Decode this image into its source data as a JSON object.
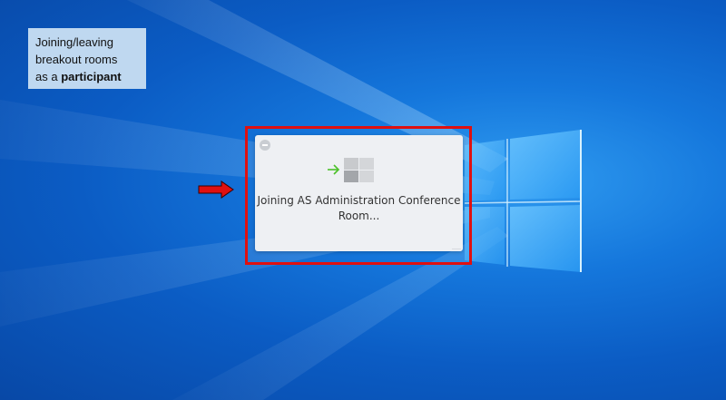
{
  "caption": {
    "line1": "Joining/leaving",
    "line2": "breakout rooms",
    "line3_prefix": "as a ",
    "line3_bold": "participant"
  },
  "toast": {
    "line1": "Joining AS Administration Conference",
    "line2": "Room..."
  },
  "icons": {
    "pointer": "right-arrow-icon",
    "join": "join-room-icon",
    "minimize": "minimize-icon"
  },
  "colors": {
    "highlight_border": "#e01010",
    "arrow_fill": "#e01010",
    "join_arrow": "#4cc12a",
    "caption_background": "#bfd8f0"
  }
}
